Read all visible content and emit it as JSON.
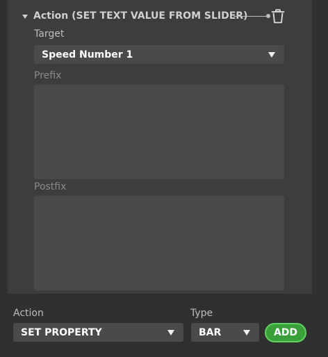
{
  "action_block": {
    "title": "Action (SET TEXT VALUE FROM SLIDER)",
    "target": {
      "label": "Target",
      "value": "Speed Number 1"
    },
    "prefix": {
      "label": "Prefix",
      "value": ""
    },
    "postfix": {
      "label": "Postfix",
      "value": ""
    }
  },
  "footer": {
    "action": {
      "label": "Action",
      "value": "SET PROPERTY"
    },
    "type": {
      "label": "Type",
      "value": "BAR"
    },
    "add_label": "ADD"
  },
  "colors": {
    "background": "#303030",
    "panel": "#3d3d3d",
    "field": "#4a4a4a",
    "add_button": "#3aa13a",
    "add_button_border": "#5fd45f"
  },
  "icons": {
    "collapse": "triangle-down-icon",
    "delete": "trash-icon",
    "dropdown": "chevron-down-icon"
  }
}
